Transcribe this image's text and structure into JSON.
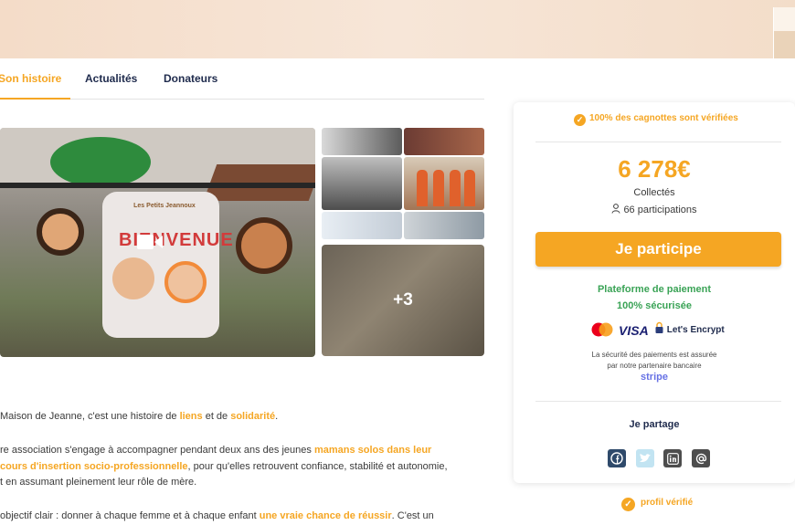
{
  "tabs": [
    {
      "label": "Son histoire",
      "active": true
    },
    {
      "label": "Actualités",
      "active": false
    },
    {
      "label": "Donateurs",
      "active": false
    }
  ],
  "gallery": {
    "main_sign_text": "BIENVENUE !",
    "sign_brand": "Les Petits Jeannoux",
    "more_count": "+3"
  },
  "story": {
    "p1": {
      "a": "Maison de Jeanne, c'est une histoire de ",
      "b": "liens",
      "c": " et de ",
      "d": "solidarité",
      "e": "."
    },
    "p2": {
      "l1a": "re association s'engage à  accompagner pendant deux ans des jeunes ",
      "l1b": "mamans solos dans leur",
      "l2a": "cours d'insertion socio-professionnelle",
      "l2b": ", pour qu'elles retrouvent confiance, stabilité et autonomie,",
      "l3": "t en assumant pleinement leur rôle de mère."
    },
    "p3": {
      "a": "objectif clair : donner à chaque femme et à chaque enfant ",
      "b": "une vraie chance de réussir",
      "c": ". C'est un"
    }
  },
  "card": {
    "verified_top": "100% des cagnottes sont vérifiées",
    "amount": "6 278€",
    "collected_label": "Collectés",
    "participations": "66 participations",
    "cta": "Je participe",
    "platform_line1": "Plateforme de paiement",
    "platform_line2": "100% sécurisée",
    "visa": "VISA",
    "letsencrypt": "Let's Encrypt",
    "security_line1": "La sécurité des paiements est assurée",
    "security_line2": "par notre partenaire bancaire",
    "stripe": "stripe",
    "share_label": "Je partage"
  },
  "verified_profile": "profil vérifié",
  "colors": {
    "accent": "#f5a623",
    "green": "#3aa356",
    "navy": "#1f2b4d"
  },
  "icons": [
    "check-icon",
    "user-icon",
    "video-icon",
    "mastercard-icon",
    "lock-icon",
    "facebook-icon",
    "twitter-icon",
    "linkedin-icon",
    "email-icon"
  ]
}
